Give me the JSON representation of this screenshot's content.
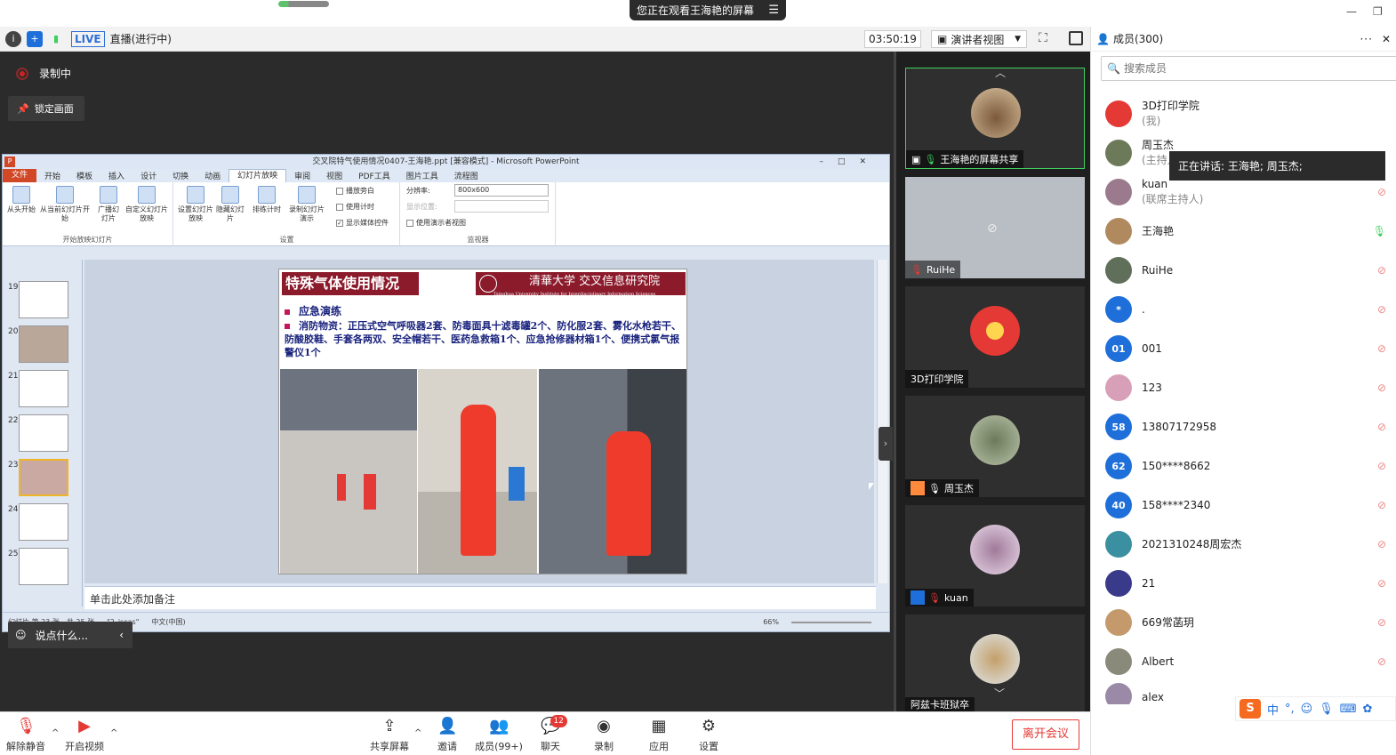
{
  "window": {
    "share_banner": "您正在观看王海艳的屏幕",
    "share_banner_icon": "menu-icon"
  },
  "toolbar": {
    "live_badge": "LIVE",
    "live_status": "直播(进行中)",
    "timer": "03:50:19",
    "view_select": "演讲者视图"
  },
  "stage": {
    "recording_label": "录制中",
    "lock_label": "锁定画面",
    "chat_placeholder": "说点什么..."
  },
  "ppt": {
    "window_title": "交叉院特气使用情况0407-王海艳.ppt [兼容模式] - Microsoft PowerPoint",
    "tabs": [
      "文件",
      "开始",
      "模板",
      "插入",
      "设计",
      "切换",
      "动画",
      "幻灯片放映",
      "审阅",
      "视图",
      "PDF工具",
      "图片工具",
      "流程图"
    ],
    "active_tab": "幻灯片放映",
    "ribbon": {
      "from_start": "从头开始",
      "from_current": "从当前幻灯片开始",
      "broadcast": "广播幻灯片",
      "custom": "自定义幻灯片放映",
      "group1": "开始放映幻灯片",
      "setup": "设置幻灯片放映",
      "hide": "隐藏幻灯片",
      "rehearse": "排练计时",
      "record": "录制幻灯片演示",
      "play_narration": "播放旁白",
      "use_timing": "使用计时",
      "show_media": "显示媒体控件",
      "group2": "设置",
      "resolution_label": "分辨率:",
      "resolution_value": "800x600",
      "show_on": "显示位置:",
      "presenter_view": "使用演示者视图",
      "group3": "监视器"
    },
    "thumb_numbers": [
      "19",
      "20",
      "21",
      "22",
      "23",
      "24",
      "25"
    ],
    "selected_thumb": "23",
    "slide": {
      "title": "特殊气体使用情况",
      "logo_text": "清華大学 交叉信息研究院",
      "logo_sub": "Tsinghua University  Institute for Interdisciplinary Information Sciences",
      "bullet1": "应急演练",
      "bullet2": "消防物资：正压式空气呼吸器2套、防毒面具十滤毒罐2个、防化服2套、雾化水枪若干、防酸胶鞋、手套各两双、安全帽若干、医药急救箱1个、应急抢修器材箱1个、便携式氯气报警仪1个"
    },
    "notes_placeholder": "单击此处添加备注",
    "status": {
      "slide_info": "幻灯片 第 23 张，共 25 张",
      "theme": "\"2_iscas\"",
      "language": "中文(中国)",
      "zoom": "66%"
    }
  },
  "videos": [
    {
      "name": "王海艳的屏幕共享",
      "icon": "screen-share-icon"
    },
    {
      "name": "RuiHe",
      "icon": "mic-muted-icon"
    },
    {
      "name": "3D打印学院",
      "icon": ""
    },
    {
      "name": "周玉杰",
      "icon": "mic-icon"
    },
    {
      "name": "kuan",
      "icon": "mic-muted-icon"
    },
    {
      "name": "阿兹卡班狱卒",
      "icon": ""
    }
  ],
  "bottom": {
    "unmute": "解除静音",
    "start_video": "开启视频",
    "share_screen": "共享屏幕",
    "invite": "邀请",
    "members": "成员(99+)",
    "chat": "聊天",
    "chat_badge": "12",
    "record": "录制",
    "apps": "应用",
    "settings": "设置",
    "leave": "离开会议"
  },
  "members": {
    "title": "成员(300)",
    "search_placeholder": "搜索成员",
    "speaking": "正在讲话: 王海艳; 周玉杰;",
    "list": [
      {
        "name": "3D打印学院",
        "role": "(我)",
        "avatar": "",
        "color": "#e53935"
      },
      {
        "name": "周玉杰",
        "role": "(主持人)",
        "avatar": "",
        "color": "#6d7a5a"
      },
      {
        "name": "kuan",
        "role": "(联席主持人)",
        "avatar": "",
        "color": "#9b7a8e"
      },
      {
        "name": "王海艳",
        "role": "",
        "avatar": "",
        "color": "#b08a5e"
      },
      {
        "name": "RuiHe",
        "role": "",
        "avatar": "",
        "color": "#5f6f5a"
      },
      {
        "name": ".",
        "role": "",
        "avatar": "*",
        "color": "#1e6fd9"
      },
      {
        "name": "001",
        "role": "",
        "avatar": "01",
        "color": "#1e6fd9"
      },
      {
        "name": "123",
        "role": "",
        "avatar": "",
        "color": "#d8a0b8"
      },
      {
        "name": "13807172958",
        "role": "",
        "avatar": "58",
        "color": "#1e6fd9"
      },
      {
        "name": "150****8662",
        "role": "",
        "avatar": "62",
        "color": "#1e6fd9"
      },
      {
        "name": "158****2340",
        "role": "",
        "avatar": "40",
        "color": "#1e6fd9"
      },
      {
        "name": "2021310248周宏杰",
        "role": "",
        "avatar": "",
        "color": "#3a8fa0"
      },
      {
        "name": "21",
        "role": "",
        "avatar": "",
        "color": "#3a3a8a"
      },
      {
        "name": "669常菡玥",
        "role": "",
        "avatar": "",
        "color": "#c49a6c"
      },
      {
        "name": "Albert",
        "role": "",
        "avatar": "",
        "color": "#8a8a7a"
      },
      {
        "name": "alex",
        "role": "",
        "avatar": "",
        "color": "#9a8aa8"
      }
    ]
  },
  "ime": {
    "logo": "S",
    "mode": "中"
  }
}
